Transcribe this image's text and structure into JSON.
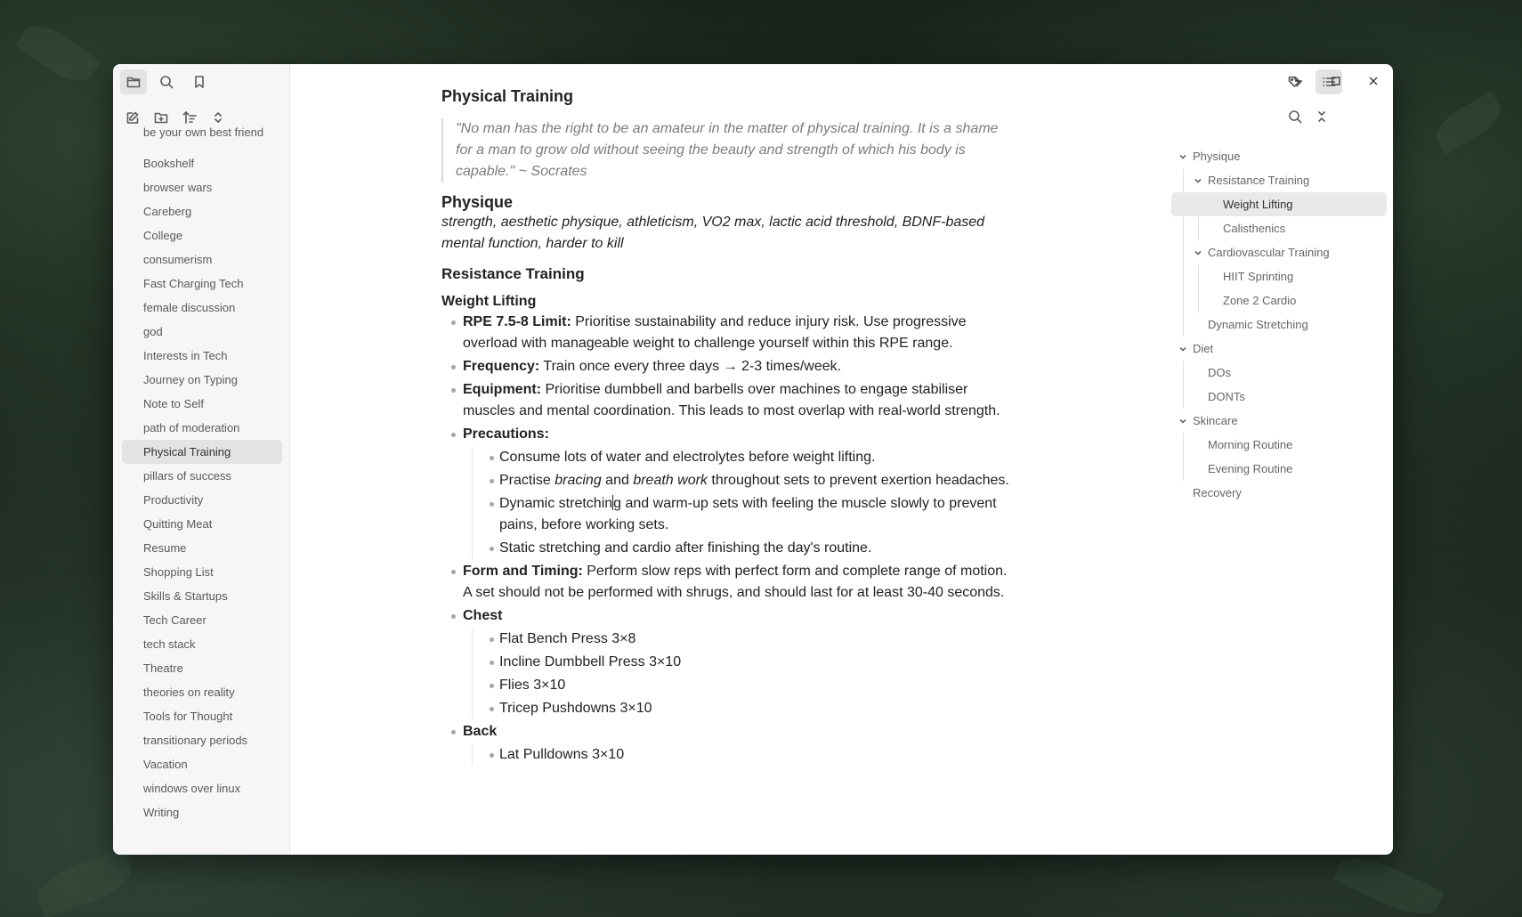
{
  "sidebar": {
    "files": [
      "be your own best friend",
      "Bookshelf",
      "browser wars",
      "Careberg",
      "College",
      "consumerism",
      "Fast Charging Tech",
      "female discussion",
      "god",
      "Interests in Tech",
      "Journey on Typing",
      "Note to Self",
      "path of moderation",
      "Physical Training",
      "pillars of success",
      "Productivity",
      "Quitting Meat",
      "Resume",
      "Shopping List",
      "Skills & Startups",
      "Tech Career",
      "tech stack",
      "Theatre",
      "theories on reality",
      "Tools for Thought",
      "transitionary periods",
      "Vacation",
      "windows over linux",
      "Writing"
    ],
    "active_file": "Physical Training"
  },
  "doc": {
    "title": "Physical Training",
    "quote": "\"No man has the right to be an amateur in the matter of physical training. It is a shame for a man to grow old without seeing the beauty and strength of which his body is capable.\" ~ Socrates",
    "physique_heading": "Physique",
    "physique_tags": "strength, aesthetic physique, athleticism, VO2 max, lactic acid threshold, BDNF-based mental function, harder to kill",
    "resistance_heading": "Resistance Training",
    "weight_heading": "Weight Lifting",
    "rpe_label": "RPE 7.5-8 Limit:",
    "rpe_text": " Prioritise sustainability and reduce injury risk. Use progressive overload with manageable weight to challenge yourself within this RPE range.",
    "freq_label": "Frequency:",
    "freq_text": " Train once every three days → 2-3 times/week.",
    "equip_label": "Equipment:",
    "equip_text": " Prioritise dumbbell and barbells over machines to engage stabiliser muscles and mental coordination. This leads to most overlap with real-world strength.",
    "prec_label": "Precautions:",
    "prec_1": "Consume lots of water and electrolytes before weight lifting.",
    "prec_2a": "Practise ",
    "prec_2b": "bracing",
    "prec_2c": " and ",
    "prec_2d": "breath work",
    "prec_2e": " throughout sets to prevent exertion headaches.",
    "prec_3a": "Dynamic stretchin",
    "prec_3b": "g and warm-up sets with feeling the muscle slowly to prevent pains, before working sets.",
    "prec_4": "Static stretching and cardio after finishing the day's routine.",
    "form_label": "Form and Timing:",
    "form_text": " Perform slow reps with perfect form and complete range of motion. A set should not be performed with shrugs, and should last for at least 30-40 seconds.",
    "chest_label": "Chest",
    "chest_items": [
      "Flat Bench Press 3×8",
      "Incline Dumbbell Press 3×10",
      "Flies 3×10",
      "Tricep Pushdowns 3×10"
    ],
    "back_label": "Back",
    "back_items": [
      "Lat Pulldowns 3×10"
    ]
  },
  "outline": {
    "items": [
      "Physique",
      "Resistance Training",
      "Weight Lifting",
      "Calisthenics",
      "Cardiovascular Training",
      "HIIT Sprinting",
      "Zone 2 Cardio",
      "Dynamic Stretching",
      "Diet",
      "DOs",
      "DONTs",
      "Skincare",
      "Morning Routine",
      "Evening Routine",
      "Recovery"
    ],
    "active": "Weight Lifting"
  }
}
